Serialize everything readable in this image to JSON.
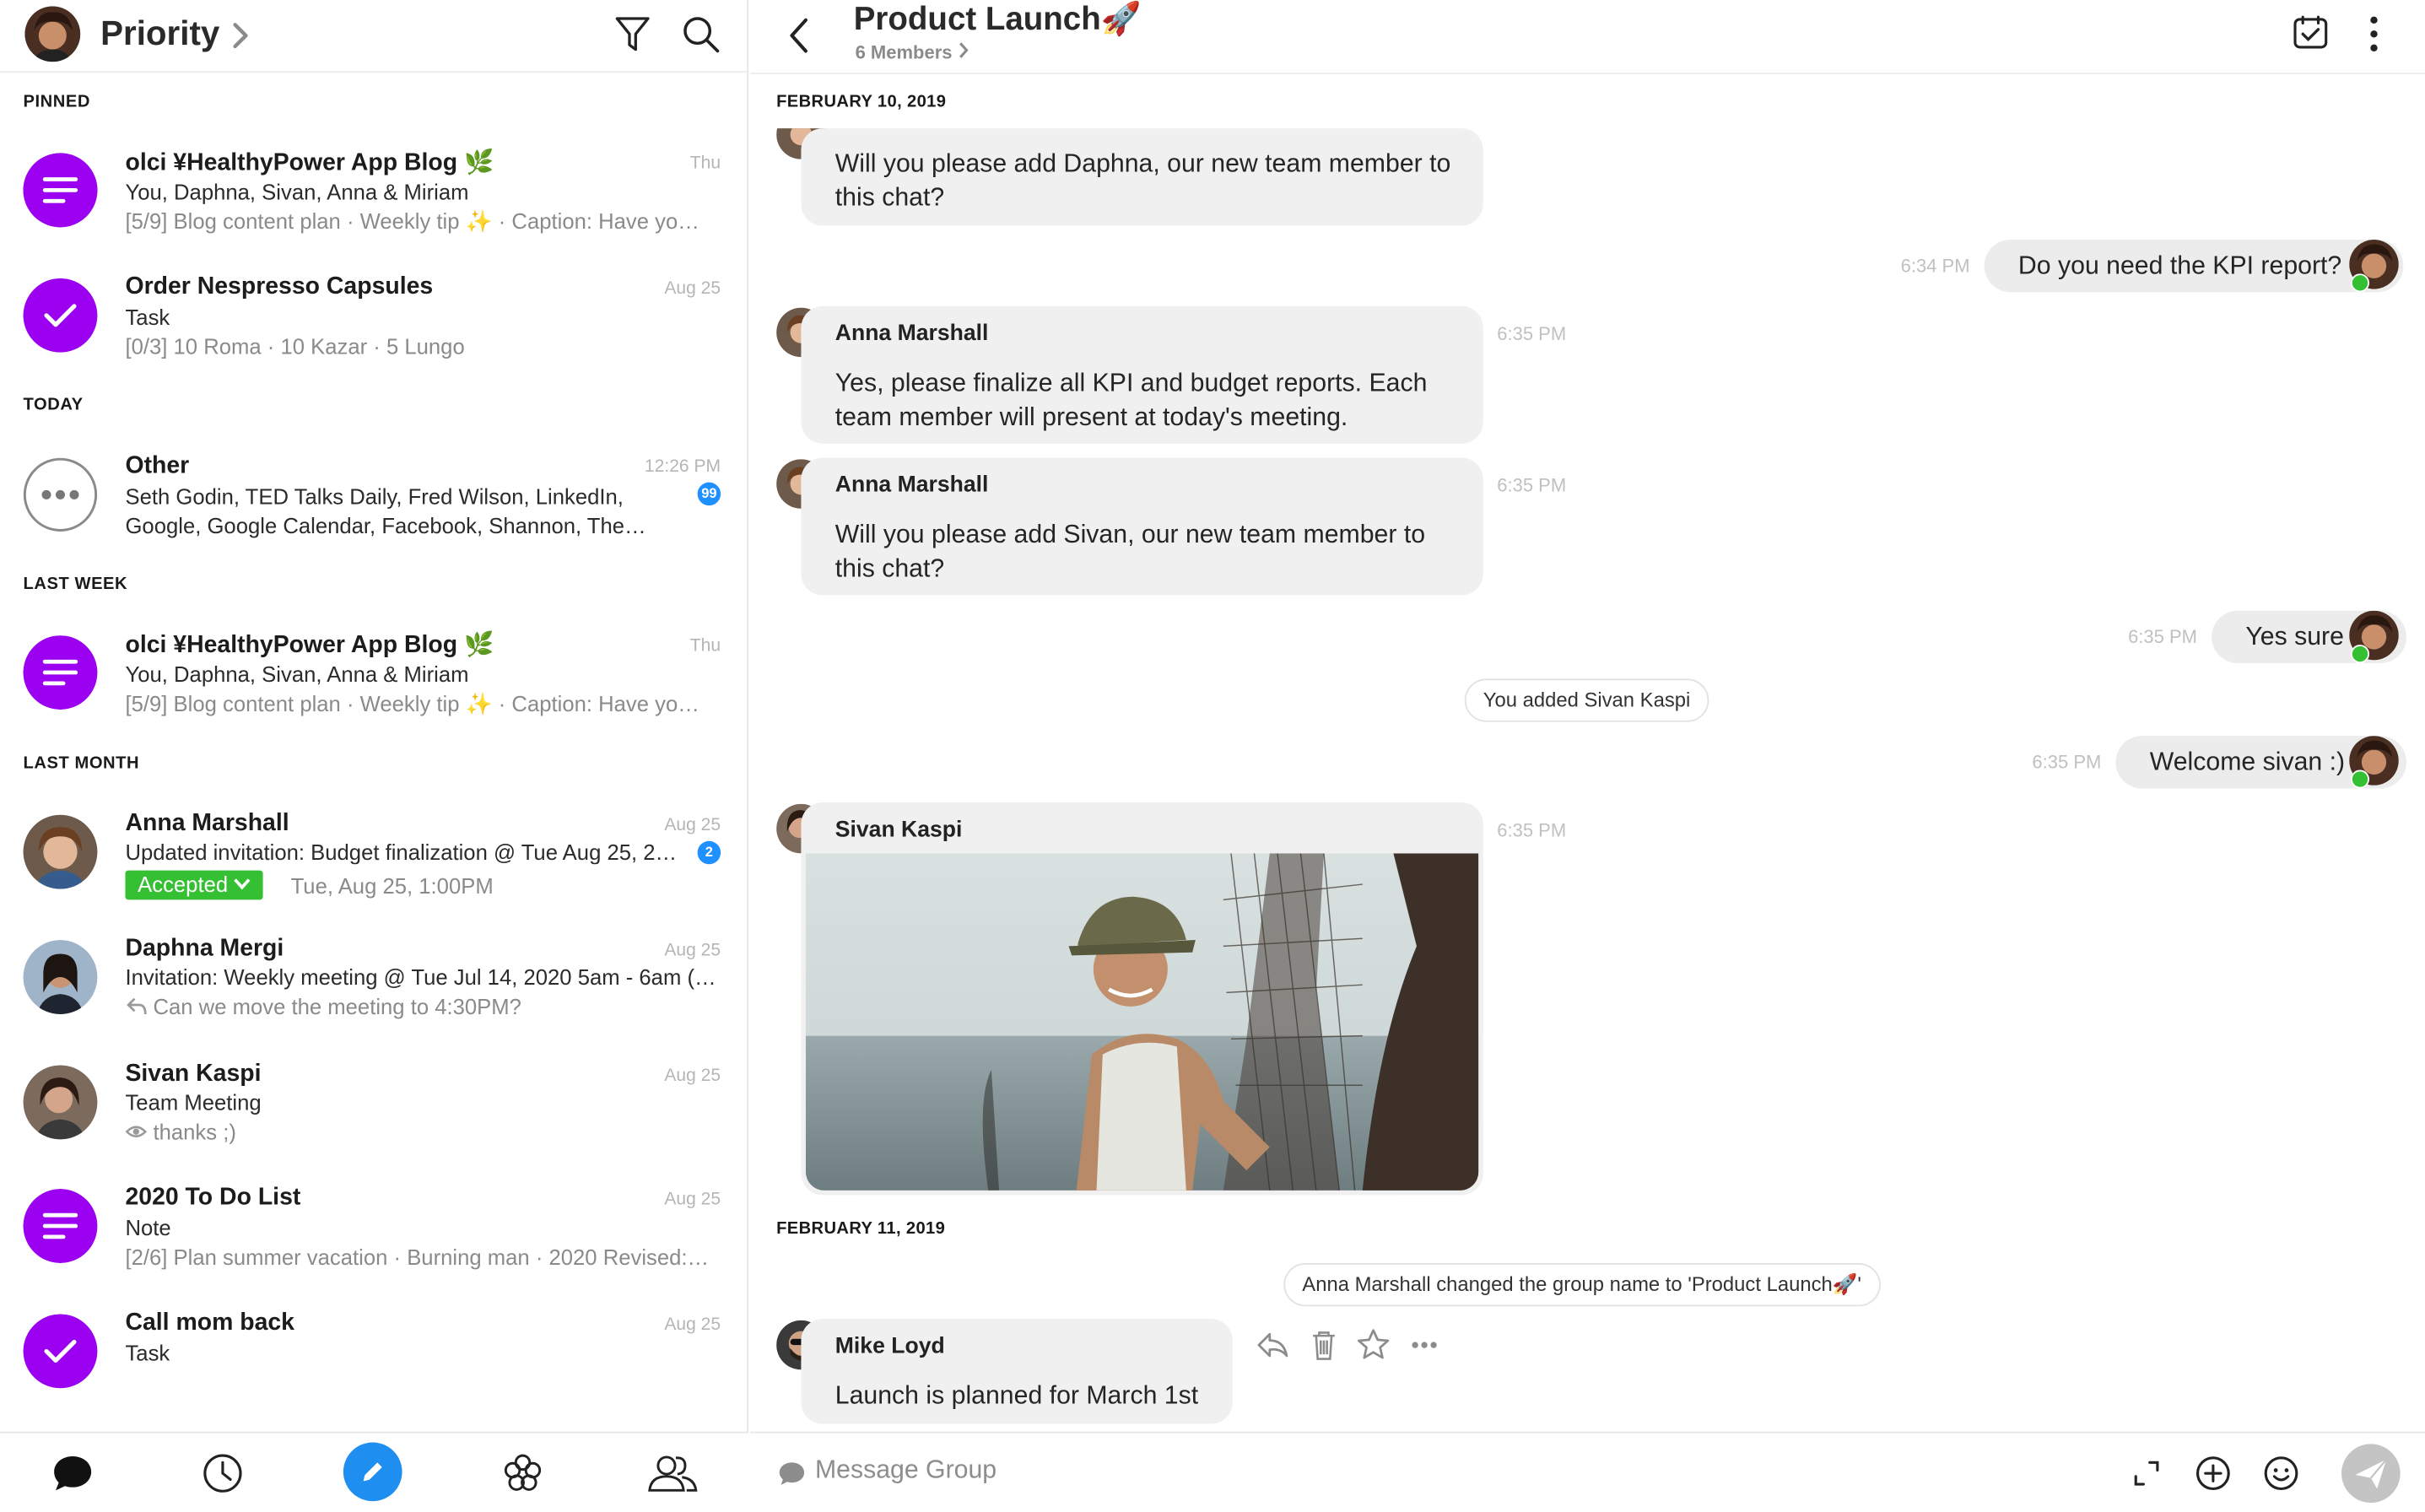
{
  "left": {
    "header": {
      "title": "Priority"
    },
    "sections": {
      "pinned": "PINNED",
      "today": "TODAY",
      "last_week": "LAST WEEK",
      "last_month": "LAST MONTH"
    },
    "conversations": [
      {
        "name": "olci ¥HealthyPower App Blog 🌿",
        "line1": "You, Daphna, Sivan, Anna & Miriam",
        "line2": "[5/9] Blog content plan · Weekly tip ✨ · Caption: Have yo…",
        "time": "Thu",
        "icon": "list-icon"
      },
      {
        "name": "Order Nespresso Capsules",
        "line1": "Task",
        "line2": "[0/3] 10 Roma · 10 Kazar · 5 Lungo",
        "time": "Aug 25",
        "icon": "check-icon"
      },
      {
        "name": "Other",
        "line1": "Seth Godin, TED Talks Daily, Fred Wilson, LinkedIn,",
        "line2": "Google, Google Calendar, Facebook, Shannon, The…",
        "time": "12:26 PM",
        "badge": "99",
        "icon": "more-horizontal-icon"
      },
      {
        "name": "olci ¥HealthyPower App Blog 🌿",
        "line1": "You, Daphna, Sivan, Anna & Miriam",
        "line2": "[5/9] Blog content plan · Weekly tip ✨ · Caption: Have yo…",
        "time": "Thu",
        "icon": "list-icon"
      },
      {
        "name": "Anna Marshall",
        "line1": "Updated invitation: Budget finalization @ Tue Aug 25, 2…",
        "accepted": "Accepted",
        "line2": "Tue, Aug 25, 1:00PM",
        "time": "Aug 25",
        "badge": "2"
      },
      {
        "name": "Daphna Mergi",
        "line1": "Invitation: Weekly meeting @ Tue Jul 14, 2020 5am - 6am (…",
        "line2": "Can we move the meeting to 4:30PM?",
        "time": "Aug 25"
      },
      {
        "name": "Sivan Kaspi",
        "line1": "Team Meeting",
        "line2": "thanks ;)",
        "time": "Aug 25"
      },
      {
        "name": "2020 To Do List",
        "line1": "Note",
        "line2": "[2/6] Plan summer vacation · Burning man · 2020 Revised:…",
        "time": "Aug 25",
        "icon": "list-icon"
      },
      {
        "name": "Call mom back",
        "line1": "Task",
        "time": "Aug 25",
        "icon": "check-icon"
      }
    ]
  },
  "chat": {
    "title": "Product Launch🚀",
    "members": "6 Members",
    "dates": [
      "FEBRUARY 10, 2019",
      "FEBRUARY 11, 2019"
    ],
    "messages": {
      "m1_text": "Will you please add Daphna, our new team member to this chat?",
      "m2_text": "Do you need the KPI report?",
      "m2_time": "6:34 PM",
      "m3_sender": "Anna Marshall",
      "m3_text": "Yes, please finalize all KPI and budget reports. Each team member will present at today's meeting.",
      "m3_time": "6:35 PM",
      "m4_sender": "Anna Marshall",
      "m4_text": "Will you please add Sivan, our new team member to this chat?",
      "m4_time": "6:35 PM",
      "m5_text": "Yes sure",
      "m5_time": "6:35 PM",
      "sys1": "You added Sivan Kaspi",
      "m6_text": "Welcome sivan :)",
      "m6_time": "6:35 PM",
      "m7_sender": "Sivan Kaspi",
      "m7_time": "6:35 PM",
      "sys2": "Anna Marshall changed the group name to 'Product Launch🚀'",
      "m8_sender": "Mike Loyd",
      "m8_text": "Launch is planned for March 1st"
    },
    "composer_placeholder": "Message Group"
  },
  "colors": {
    "accent_purple": "#9b00f0",
    "accent_blue": "#1e8ef0",
    "accepted_green": "#35c033",
    "badge_blue": "#1e90ff"
  }
}
